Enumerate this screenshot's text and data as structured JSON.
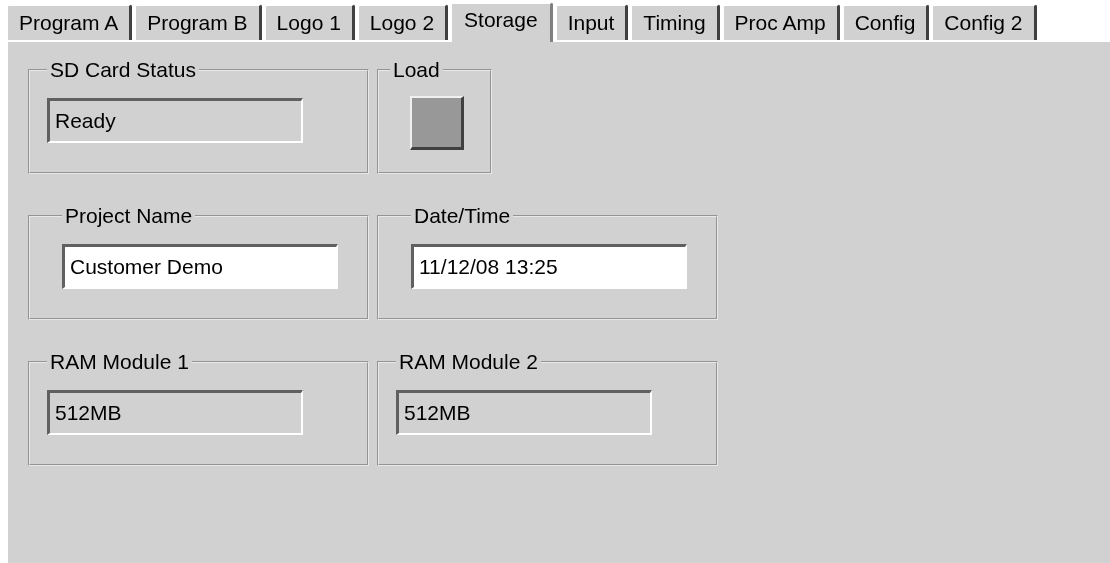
{
  "tabs": [
    {
      "label": "Program A",
      "selected": false
    },
    {
      "label": "Program B",
      "selected": false
    },
    {
      "label": "Logo 1",
      "selected": false
    },
    {
      "label": "Logo 2",
      "selected": false
    },
    {
      "label": "Storage",
      "selected": true
    },
    {
      "label": "Input",
      "selected": false
    },
    {
      "label": "Timing",
      "selected": false
    },
    {
      "label": "Proc Amp",
      "selected": false
    },
    {
      "label": "Config",
      "selected": false
    },
    {
      "label": "Config 2",
      "selected": false
    }
  ],
  "groups": [
    {
      "title": "SD Card Status",
      "kind": "readonly",
      "value": "Ready"
    },
    {
      "title": "Load",
      "kind": "button"
    },
    {
      "title": "Project Name",
      "kind": "input",
      "value": "Customer Demo"
    },
    {
      "title": "Date/Time",
      "kind": "input",
      "value": "11/12/08 13:25"
    },
    {
      "title": "RAM Module 1",
      "kind": "readonly",
      "value": "512MB"
    },
    {
      "title": "RAM Module 2",
      "kind": "readonly",
      "value": "512MB"
    }
  ]
}
